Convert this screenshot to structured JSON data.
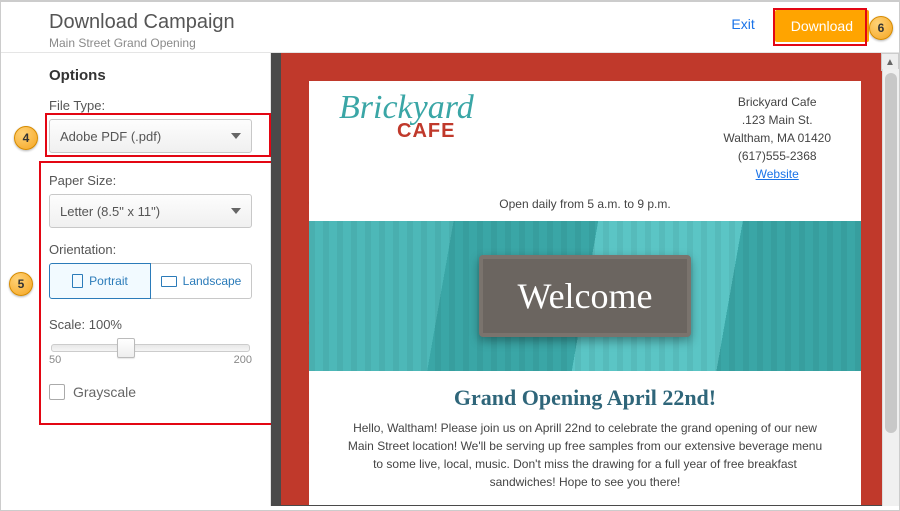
{
  "header": {
    "title": "Download Campaign",
    "subtitle": "Main Street Grand Opening",
    "exit": "Exit",
    "download": "Download"
  },
  "options": {
    "heading": "Options",
    "file_type": {
      "label": "File Type:",
      "value": "Adobe PDF (.pdf)"
    },
    "paper_size": {
      "label": "Paper Size:",
      "value": "Letter (8.5\" x 11\")"
    },
    "orientation": {
      "label": "Orientation:",
      "portrait": "Portrait",
      "landscape": "Landscape",
      "selected": "Portrait"
    },
    "scale": {
      "label": "Scale: 100%",
      "value": 100,
      "min": "50",
      "max": "200"
    },
    "grayscale": "Grayscale"
  },
  "preview": {
    "logo_line1": "Brickyard",
    "logo_line2": "CAFE",
    "addr": {
      "name": "Brickyard Cafe",
      "street": ".123 Main St.",
      "city": "Waltham, MA 01420",
      "phone": "(617)555-2368",
      "website": "Website"
    },
    "tagline": "Open daily from 5 a.m. to 9 p.m.",
    "sign": "Welcome",
    "headline": "Grand Opening April 22nd!",
    "body": "Hello, Waltham! Please join us on Aprill 22nd to celebrate the grand opening of our new Main Street location! We'll be serving up free samples from our extensive beverage menu to some live, local, music. Don't miss the drawing for a full year of free breakfast sandwiches! Hope to see you there!"
  },
  "callouts": {
    "c4": "4",
    "c5": "5",
    "c6": "6"
  }
}
